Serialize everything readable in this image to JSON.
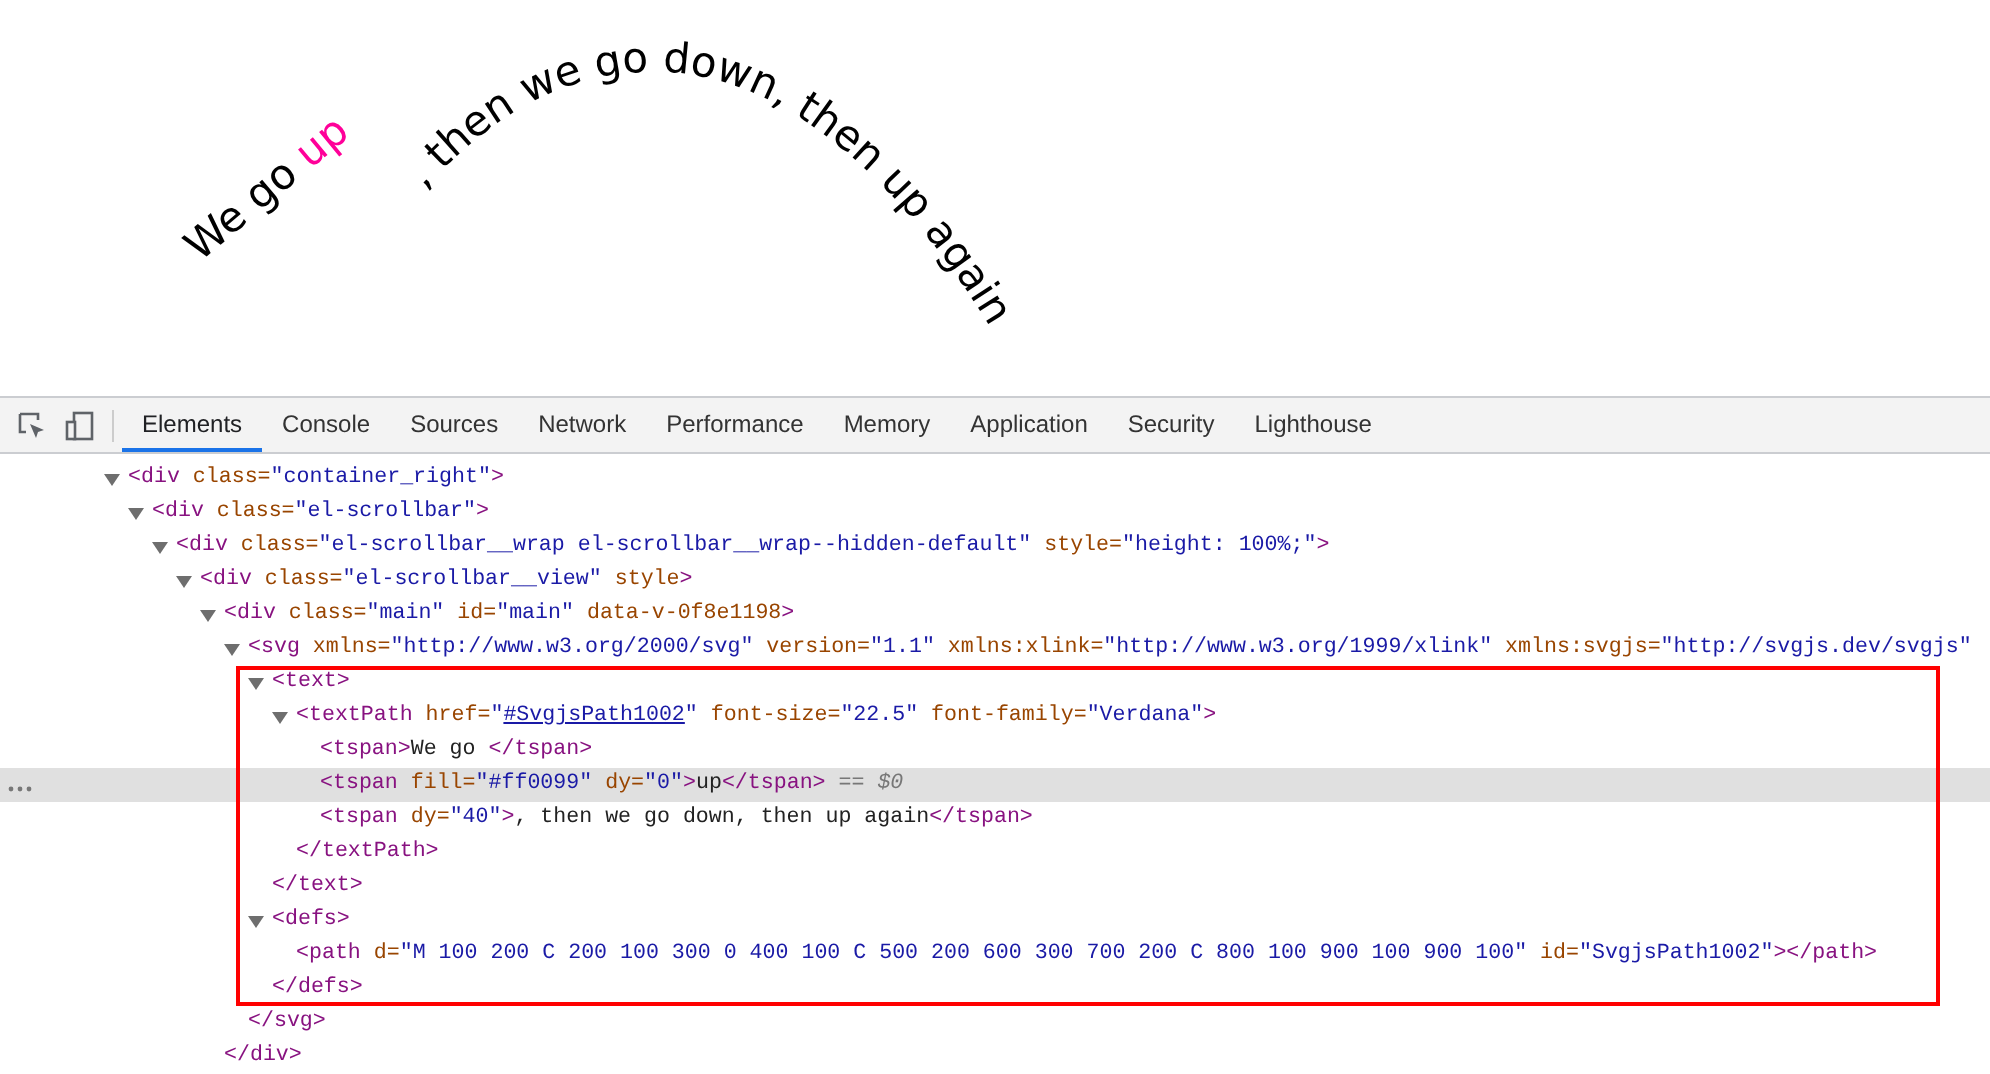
{
  "canvas": {
    "segments": [
      {
        "text": "We go ",
        "color": "#000000"
      },
      {
        "text": "up",
        "color": "#ff0099"
      },
      {
        "text": ", then we go down, then up again",
        "color": "#000000"
      }
    ]
  },
  "devtools": {
    "tabs": [
      {
        "label": "Elements",
        "selected": true
      },
      {
        "label": "Console",
        "selected": false
      },
      {
        "label": "Sources",
        "selected": false
      },
      {
        "label": "Network",
        "selected": false
      },
      {
        "label": "Performance",
        "selected": false
      },
      {
        "label": "Memory",
        "selected": false
      },
      {
        "label": "Application",
        "selected": false
      },
      {
        "label": "Security",
        "selected": false
      },
      {
        "label": "Lighthouse",
        "selected": false
      }
    ],
    "dom_tree": [
      {
        "line": [
          {
            "kind": "tag",
            "text": "<div"
          },
          {
            "kind": "attr",
            "text": " class="
          },
          {
            "kind": "value",
            "text": "\"container_right\""
          },
          {
            "kind": "tag",
            "text": ">"
          }
        ],
        "expanded": true,
        "selected": false,
        "children": [
          {
            "line": [
              {
                "kind": "tag",
                "text": "<div"
              },
              {
                "kind": "attr",
                "text": " class="
              },
              {
                "kind": "value",
                "text": "\"el-scrollbar\""
              },
              {
                "kind": "tag",
                "text": ">"
              }
            ],
            "expanded": true,
            "selected": false,
            "children": [
              {
                "line": [
                  {
                    "kind": "tag",
                    "text": "<div"
                  },
                  {
                    "kind": "attr",
                    "text": " class="
                  },
                  {
                    "kind": "value",
                    "text": "\"el-scrollbar__wrap el-scrollbar__wrap--hidden-default\""
                  },
                  {
                    "kind": "attr",
                    "text": " style="
                  },
                  {
                    "kind": "value",
                    "text": "\"height: 100%;\""
                  },
                  {
                    "kind": "tag",
                    "text": ">"
                  }
                ],
                "expanded": true,
                "selected": false,
                "children": [
                  {
                    "line": [
                      {
                        "kind": "tag",
                        "text": "<div"
                      },
                      {
                        "kind": "attr",
                        "text": " class="
                      },
                      {
                        "kind": "value",
                        "text": "\"el-scrollbar__view\""
                      },
                      {
                        "kind": "attr",
                        "text": " style"
                      },
                      {
                        "kind": "tag",
                        "text": ">"
                      }
                    ],
                    "expanded": true,
                    "selected": false,
                    "children": [
                      {
                        "line": [
                          {
                            "kind": "tag",
                            "text": "<div"
                          },
                          {
                            "kind": "attr",
                            "text": " class="
                          },
                          {
                            "kind": "value",
                            "text": "\"main\""
                          },
                          {
                            "kind": "attr",
                            "text": " id="
                          },
                          {
                            "kind": "value",
                            "text": "\"main\""
                          },
                          {
                            "kind": "attr",
                            "text": " data-v-0f8e1198"
                          },
                          {
                            "kind": "tag",
                            "text": ">"
                          }
                        ],
                        "expanded": true,
                        "selected": false,
                        "closing": [
                          {
                            "kind": "tag",
                            "text": "</div>"
                          }
                        ],
                        "children": [
                          {
                            "line": [
                              {
                                "kind": "tag",
                                "text": "<svg"
                              },
                              {
                                "kind": "attr",
                                "text": " xmlns="
                              },
                              {
                                "kind": "value",
                                "text": "\"http://www.w3.org/2000/svg\""
                              },
                              {
                                "kind": "attr",
                                "text": " version="
                              },
                              {
                                "kind": "value",
                                "text": "\"1.1\""
                              },
                              {
                                "kind": "attr",
                                "text": " xmlns:xlink="
                              },
                              {
                                "kind": "value",
                                "text": "\"http://www.w3.org/1999/xlink\""
                              },
                              {
                                "kind": "attr",
                                "text": " xmlns:svgjs="
                              },
                              {
                                "kind": "value",
                                "text": "\"http://svgjs.dev/svgjs\""
                              }
                            ],
                            "expanded": true,
                            "selected": false,
                            "outlined": true,
                            "closing": [
                              {
                                "kind": "tag",
                                "text": "</svg>"
                              }
                            ],
                            "children": [
                              {
                                "line": [
                                  {
                                    "kind": "tag",
                                    "text": "<text>"
                                  }
                                ],
                                "expanded": true,
                                "selected": false,
                                "closing": [
                                  {
                                    "kind": "tag",
                                    "text": "</text>"
                                  }
                                ],
                                "children": [
                                  {
                                    "line": [
                                      {
                                        "kind": "tag",
                                        "text": "<textPath"
                                      },
                                      {
                                        "kind": "attr",
                                        "text": " href="
                                      },
                                      {
                                        "kind": "punct",
                                        "text": "\""
                                      },
                                      {
                                        "kind": "link",
                                        "text": "#SvgjsPath1002"
                                      },
                                      {
                                        "kind": "punct",
                                        "text": "\""
                                      },
                                      {
                                        "kind": "attr",
                                        "text": " font-size="
                                      },
                                      {
                                        "kind": "value",
                                        "text": "\"22.5\""
                                      },
                                      {
                                        "kind": "attr",
                                        "text": " font-family="
                                      },
                                      {
                                        "kind": "value",
                                        "text": "\"Verdana\""
                                      },
                                      {
                                        "kind": "tag",
                                        "text": ">"
                                      }
                                    ],
                                    "expanded": true,
                                    "selected": false,
                                    "closing": [
                                      {
                                        "kind": "tag",
                                        "text": "</textPath>"
                                      }
                                    ],
                                    "children": [
                                      {
                                        "line": [
                                          {
                                            "kind": "tag",
                                            "text": "<tspan>"
                                          },
                                          {
                                            "kind": "text",
                                            "text": "We go "
                                          },
                                          {
                                            "kind": "tag",
                                            "text": "</tspan>"
                                          }
                                        ],
                                        "selected": false
                                      },
                                      {
                                        "line": [
                                          {
                                            "kind": "tag",
                                            "text": "<tspan"
                                          },
                                          {
                                            "kind": "attr",
                                            "text": " fill="
                                          },
                                          {
                                            "kind": "value",
                                            "text": "\"#ff0099\""
                                          },
                                          {
                                            "kind": "attr",
                                            "text": " dy="
                                          },
                                          {
                                            "kind": "value",
                                            "text": "\"0\""
                                          },
                                          {
                                            "kind": "tag",
                                            "text": ">"
                                          },
                                          {
                                            "kind": "text",
                                            "text": "up"
                                          },
                                          {
                                            "kind": "tag",
                                            "text": "</tspan>"
                                          },
                                          {
                                            "kind": "marker",
                                            "text": " == $0"
                                          }
                                        ],
                                        "selected": true
                                      },
                                      {
                                        "line": [
                                          {
                                            "kind": "tag",
                                            "text": "<tspan"
                                          },
                                          {
                                            "kind": "attr",
                                            "text": " dy="
                                          },
                                          {
                                            "kind": "value",
                                            "text": "\"40\""
                                          },
                                          {
                                            "kind": "tag",
                                            "text": ">"
                                          },
                                          {
                                            "kind": "text",
                                            "text": ", then we go down, then up again"
                                          },
                                          {
                                            "kind": "tag",
                                            "text": "</tspan>"
                                          }
                                        ],
                                        "selected": false
                                      }
                                    ]
                                  }
                                ]
                              },
                              {
                                "line": [
                                  {
                                    "kind": "tag",
                                    "text": "<defs>"
                                  }
                                ],
                                "expanded": true,
                                "selected": false,
                                "closing": [
                                  {
                                    "kind": "tag",
                                    "text": "</defs>"
                                  }
                                ],
                                "children": [
                                  {
                                    "line": [
                                      {
                                        "kind": "tag",
                                        "text": "<path"
                                      },
                                      {
                                        "kind": "attr",
                                        "text": " d="
                                      },
                                      {
                                        "kind": "value",
                                        "text": "\"M 100 200 C 200 100 300 0 400 100 C 500 200 600 300 700 200 C 800 100 900 100 900 100\""
                                      },
                                      {
                                        "kind": "attr",
                                        "text": " id="
                                      },
                                      {
                                        "kind": "value",
                                        "text": "\"SvgjsPath1002\""
                                      },
                                      {
                                        "kind": "tag",
                                        "text": "></path>"
                                      }
                                    ],
                                    "selected": false
                                  }
                                ]
                              }
                            ]
                          }
                        ]
                      }
                    ]
                  }
                ]
              }
            ]
          }
        ]
      }
    ]
  }
}
